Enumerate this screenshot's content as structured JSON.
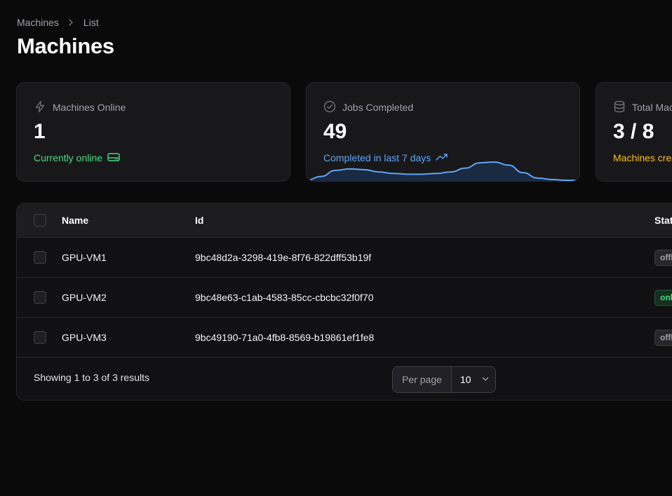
{
  "breadcrumb": {
    "parent": "Machines",
    "current": "List"
  },
  "page": {
    "title": "Machines"
  },
  "stats": [
    {
      "label": "Machines Online",
      "value": "1",
      "description": "Currently online",
      "icon": "bolt-icon",
      "color": "#4ade80"
    },
    {
      "label": "Jobs Completed",
      "value": "49",
      "description": "Completed in last 7 days",
      "icon": "check-circle-icon",
      "color": "#60a5fa",
      "chart_data": {
        "type": "area",
        "values": [
          0,
          5,
          13,
          15,
          14,
          11,
          9,
          8,
          8,
          9,
          11,
          16,
          23,
          24,
          20,
          10,
          3,
          1,
          0,
          0
        ]
      }
    },
    {
      "label": "Total Machines",
      "value": "3 / 8",
      "description": "Machines created",
      "icon": "database-icon",
      "color": "#fbbf24"
    }
  ],
  "table": {
    "columns": {
      "name": "Name",
      "id": "Id",
      "status": "Status"
    },
    "rows": [
      {
        "name": "GPU-VM1",
        "id": "9bc48d2a-3298-419e-8f76-822dff53b19f",
        "status": "offline"
      },
      {
        "name": "GPU-VM2",
        "id": "9bc48e63-c1ab-4583-85cc-cbcbc32f0f70",
        "status": "online"
      },
      {
        "name": "GPU-VM3",
        "id": "9bc49190-71a0-4fb8-8569-b19861ef1fe8",
        "status": "offline"
      }
    ],
    "footer": {
      "results": "Showing 1 to 3 of 3 results",
      "per_page_label": "Per page",
      "per_page_value": "10"
    }
  }
}
